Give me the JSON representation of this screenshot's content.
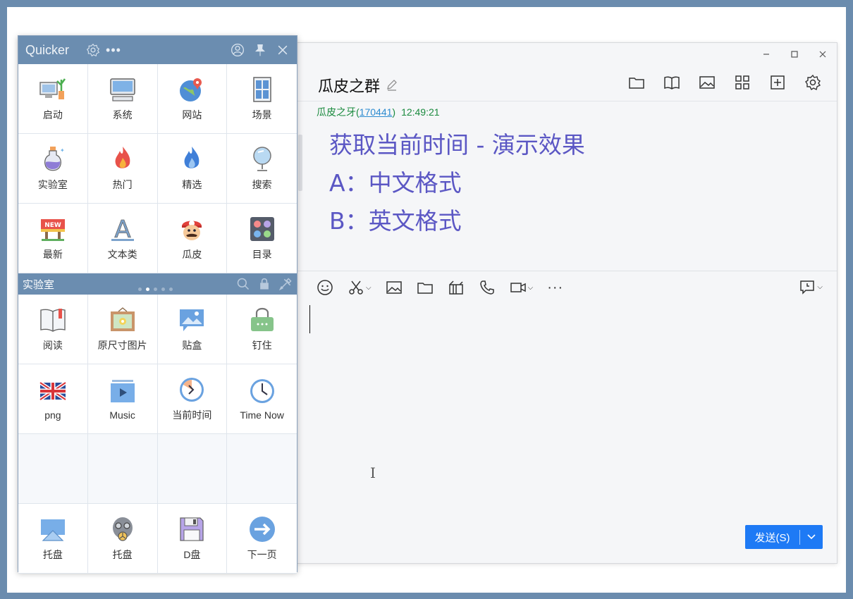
{
  "quicker": {
    "brand": "Quicker",
    "top_grid": [
      {
        "label": "启动",
        "icon": "computer-plant-icon"
      },
      {
        "label": "系统",
        "icon": "monitor-icon"
      },
      {
        "label": "网站",
        "icon": "globe-pin-icon"
      },
      {
        "label": "场景",
        "icon": "window-icon"
      },
      {
        "label": "实验室",
        "icon": "flask-icon"
      },
      {
        "label": "热门",
        "icon": "fire-icon"
      },
      {
        "label": "精选",
        "icon": "blue-flame-icon"
      },
      {
        "label": "搜索",
        "icon": "mirror-icon"
      },
      {
        "label": "最新",
        "icon": "new-sign-icon"
      },
      {
        "label": "文本类",
        "icon": "letter-a-icon"
      },
      {
        "label": "瓜皮",
        "icon": "mario-icon"
      },
      {
        "label": "目录",
        "icon": "palette-icon"
      }
    ],
    "section_title": "实验室",
    "bottom_grid": [
      {
        "label": "阅读",
        "icon": "book-icon"
      },
      {
        "label": "原尺寸图片",
        "icon": "picture-frame-icon"
      },
      {
        "label": "贴盒",
        "icon": "image-bubble-icon"
      },
      {
        "label": "钉住",
        "icon": "lock-bag-icon"
      },
      {
        "label": "png",
        "icon": "uk-flag-icon"
      },
      {
        "label": "Music",
        "icon": "video-play-icon"
      },
      {
        "label": "当前时间",
        "icon": "clock-pie-icon"
      },
      {
        "label": "Time Now",
        "icon": "clock-icon"
      }
    ],
    "footer_grid": [
      {
        "label": "托盘",
        "icon": "tray-icon"
      },
      {
        "label": "托盘",
        "icon": "gas-mask-icon"
      },
      {
        "label": "D盘",
        "icon": "floppy-icon"
      },
      {
        "label": "下一页",
        "icon": "arrow-right-circle-icon"
      }
    ]
  },
  "chat": {
    "title": "瓜皮之群",
    "sender": "瓜皮之牙",
    "sender_id": "170441",
    "time": "12:49:21",
    "lines": [
      "获取当前时间 - 演示效果",
      "A：中文格式",
      "B：英文格式"
    ],
    "send_label": "发送(S)"
  },
  "colors": {
    "accent": "#1e7af5",
    "panel_header": "#6b8db0",
    "message_text": "#5b57c4",
    "sender_green": "#1a8a3e"
  }
}
